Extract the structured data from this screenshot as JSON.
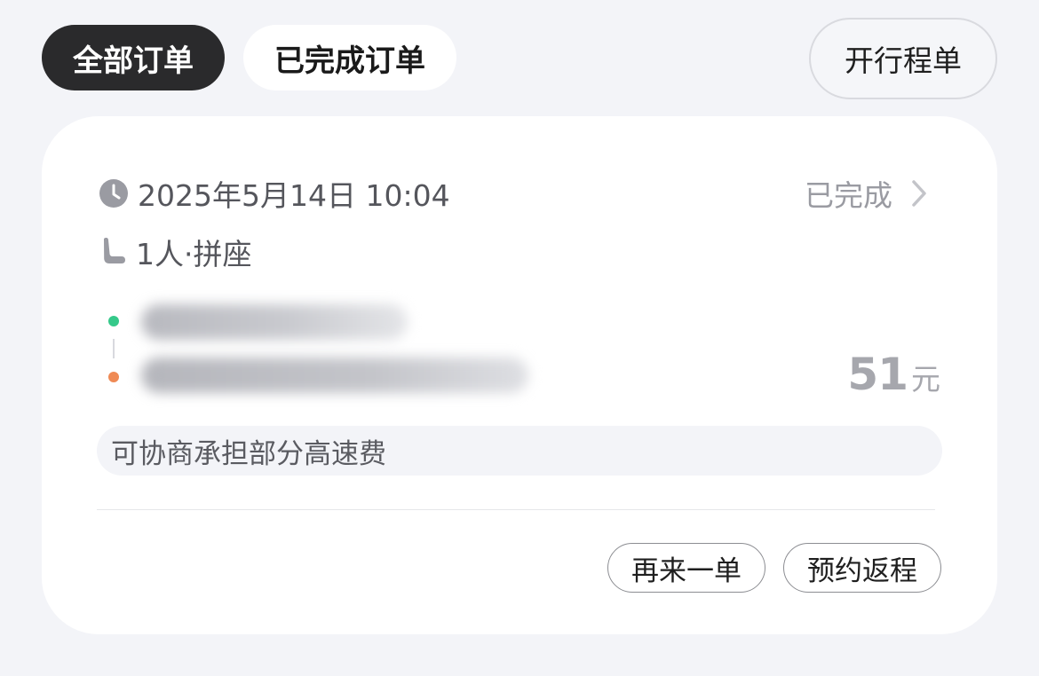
{
  "tabs": {
    "all_orders": "全部订单",
    "completed_orders": "已完成订单"
  },
  "itinerary_button": "开行程单",
  "order": {
    "datetime": "2025年5月14日 10:04",
    "status": "已完成",
    "seat_info": "1人·拼座",
    "price_value": "51",
    "price_unit": "元",
    "note": "可协商承担部分高速费",
    "actions": {
      "again": "再来一单",
      "return_trip": "预约返程"
    }
  },
  "colors": {
    "active_tab_bg": "#2a2a2c",
    "start_dot": "#35c98a",
    "end_dot": "#ef8a55",
    "muted_text": "#9a9ba2"
  },
  "icons": {
    "time": "clock-icon",
    "seat": "seat-icon",
    "status": "chevron-right-icon"
  }
}
